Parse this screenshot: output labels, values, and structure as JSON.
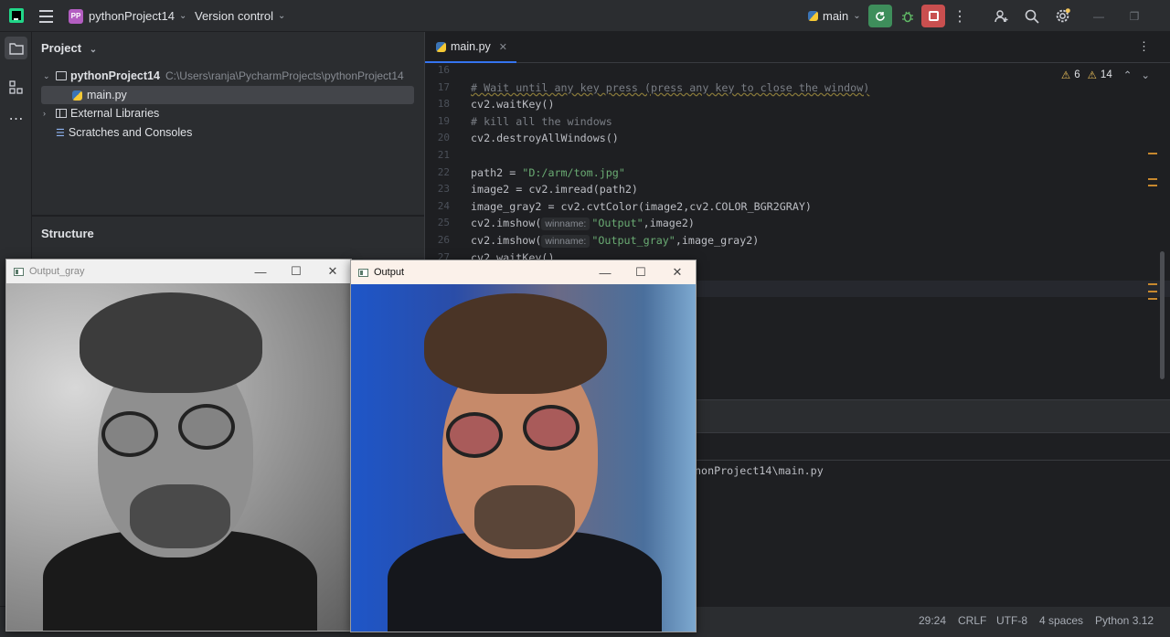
{
  "titlebar": {
    "project_badge": "PP",
    "project_name": "pythonProject14",
    "version_control": "Version control",
    "branch": "main"
  },
  "project_panel": {
    "title": "Project",
    "root_name": "pythonProject14",
    "root_path": "C:\\Users\\ranja\\PycharmProjects\\pythonProject14",
    "file": "main.py",
    "external_libraries": "External Libraries",
    "scratches": "Scratches and Consoles"
  },
  "structure_panel": {
    "title": "Structure"
  },
  "editor": {
    "tab_name": "main.py",
    "warnings": "6",
    "weak_warnings": "14",
    "lines": [
      {
        "n": "16",
        "text": ""
      },
      {
        "n": "17",
        "text": "# Wait until any key press (press any key to close the window)"
      },
      {
        "n": "18",
        "text": "cv2.waitKey()"
      },
      {
        "n": "19",
        "text": "# kill all the windows"
      },
      {
        "n": "20",
        "text": "cv2.destroyAllWindows()"
      },
      {
        "n": "21",
        "text": ""
      },
      {
        "n": "22",
        "pre": "path2 = ",
        "str": "\"D:/arm/tom.jpg\""
      },
      {
        "n": "23",
        "text": "image2 = cv2.imread(path2)"
      },
      {
        "n": "24",
        "text": "image_gray2 = cv2.cvtColor(image2,cv2.COLOR_BGR2GRAY)"
      },
      {
        "n": "25",
        "pre": "cv2.imshow(",
        "hint": "winname:",
        "str": "\"Output\"",
        "post": ",image2)"
      },
      {
        "n": "26",
        "pre": "cv2.imshow(",
        "hint": "winname:",
        "str": "\"Output_gray\"",
        "post": ",image_gray2)"
      },
      {
        "n": "27",
        "text": "cv2.waitKey()"
      }
    ]
  },
  "run_panel": {
    "output_line": "nonProject14\\main.py"
  },
  "statusbar": {
    "position": "29:24",
    "line_sep": "CRLF",
    "encoding": "UTF-8",
    "indent": "4 spaces",
    "interpreter": "Python 3.12"
  },
  "windows": {
    "gray_title": "Output_gray",
    "color_title": "Output"
  },
  "colors": {
    "accent": "#3574f0",
    "run_green": "#3e8e5b",
    "stop_red": "#c94f4f"
  }
}
